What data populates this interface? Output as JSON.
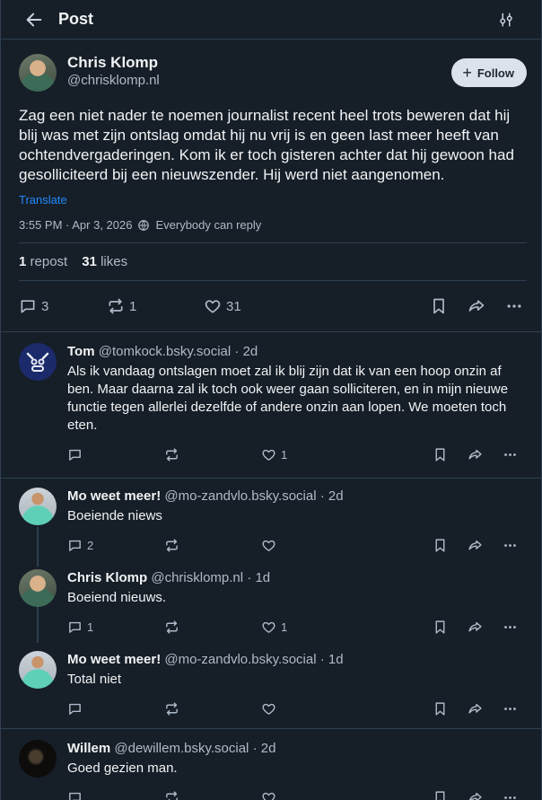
{
  "header": {
    "title": "Post",
    "back_icon": "arrow-left-icon",
    "filter_icon": "sliders-icon"
  },
  "post": {
    "author": {
      "display_name": "Chris Klomp",
      "handle": "@chrisklomp.nl"
    },
    "follow_label": "Follow",
    "text": "Zag een niet nader te noemen journalist recent heel trots beweren dat hij blij was met zijn ontslag omdat hij nu vrij is en geen last meer heeft van ochtendvergaderingen. Kom ik er toch gisteren achter dat hij gewoon had gesolliciteerd bij een nieuwszender. Hij werd niet aangenomen.",
    "translate_label": "Translate",
    "timestamp": "3:55 PM · Apr 3, 2026",
    "reply_setting": "Everybody can reply",
    "stats": {
      "reposts_count": "1",
      "reposts_label": "repost",
      "likes_count": "31",
      "likes_label": "likes"
    },
    "actions": {
      "replies": "3",
      "reposts": "1",
      "likes": "31"
    }
  },
  "replies": [
    {
      "name": "Tom",
      "handle": "@tomkock.bsky.social",
      "time": "· 2d",
      "text": "Als ik vandaag ontslagen moet zal ik blij zijn dat ik van een hoop onzin af ben. Maar daarna zal ik toch ook weer gaan solliciteren, en in mijn nieuwe functie tegen allerlei dezelfde of andere onzin aan lopen. We moeten toch eten.",
      "replies": "",
      "reposts": "",
      "likes": "1"
    },
    {
      "name": "Mo weet meer!",
      "handle": "@mo-zandvlo.bsky.social",
      "time": "· 2d",
      "text": "Boeiende niews",
      "replies": "2",
      "reposts": "",
      "likes": ""
    },
    {
      "name": "Chris Klomp",
      "handle": "@chrisklomp.nl",
      "time": "· 1d",
      "text": "Boeiend nieuws.",
      "replies": "1",
      "reposts": "",
      "likes": "1"
    },
    {
      "name": "Mo weet meer!",
      "handle": "@mo-zandvlo.bsky.social",
      "time": "· 1d",
      "text": "Total niet",
      "replies": "",
      "reposts": "",
      "likes": ""
    },
    {
      "name": "Willem",
      "handle": "@dewillem.bsky.social",
      "time": "· 2d",
      "text": "Goed gezien man.",
      "replies": "",
      "reposts": "",
      "likes": ""
    }
  ],
  "colors": {
    "background": "#161e27",
    "border": "#2e4052",
    "muted": "#aebbc9",
    "link": "#208bfe"
  }
}
